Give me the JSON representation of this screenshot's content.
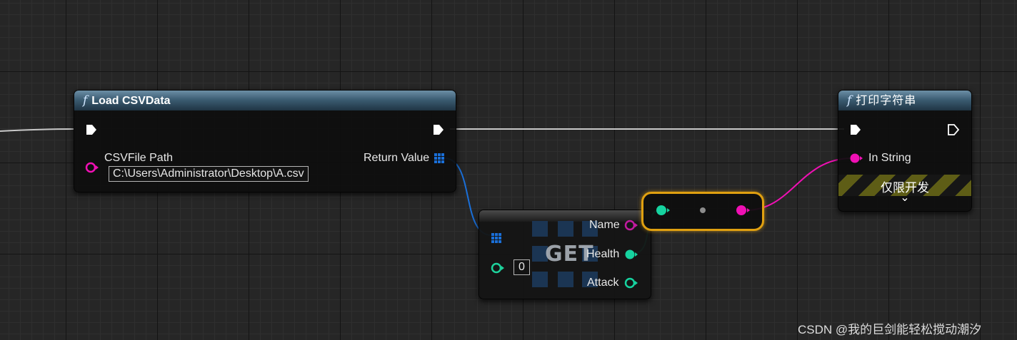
{
  "load_node": {
    "title": "Load CSVData",
    "csv_path_label": "CSVFile Path",
    "csv_path_value": "C:\\Users\\Administrator\\Desktop\\A.csv",
    "return_label": "Return Value"
  },
  "get_node": {
    "title": "GET",
    "index_value": "0",
    "pins": [
      "Name",
      "Health",
      "Attack"
    ]
  },
  "print_node": {
    "title": "打印字符串",
    "in_string_label": "In String",
    "dev_label": "仅限开发",
    "expand_glyph": "⌄"
  },
  "watermark": "CSDN @我的巨剑能轻松搅动潮汐",
  "colors": {
    "exec": "#ffffff",
    "string_pin": "#f010b4",
    "struct_pin": "#1a6fd8",
    "name_pin": "#c21aa0",
    "float_pin": "#16d3a0",
    "int_pin": "#1ed29c",
    "wire_exec": "#c8c8c8",
    "reroute_border": "#e0a010"
  }
}
